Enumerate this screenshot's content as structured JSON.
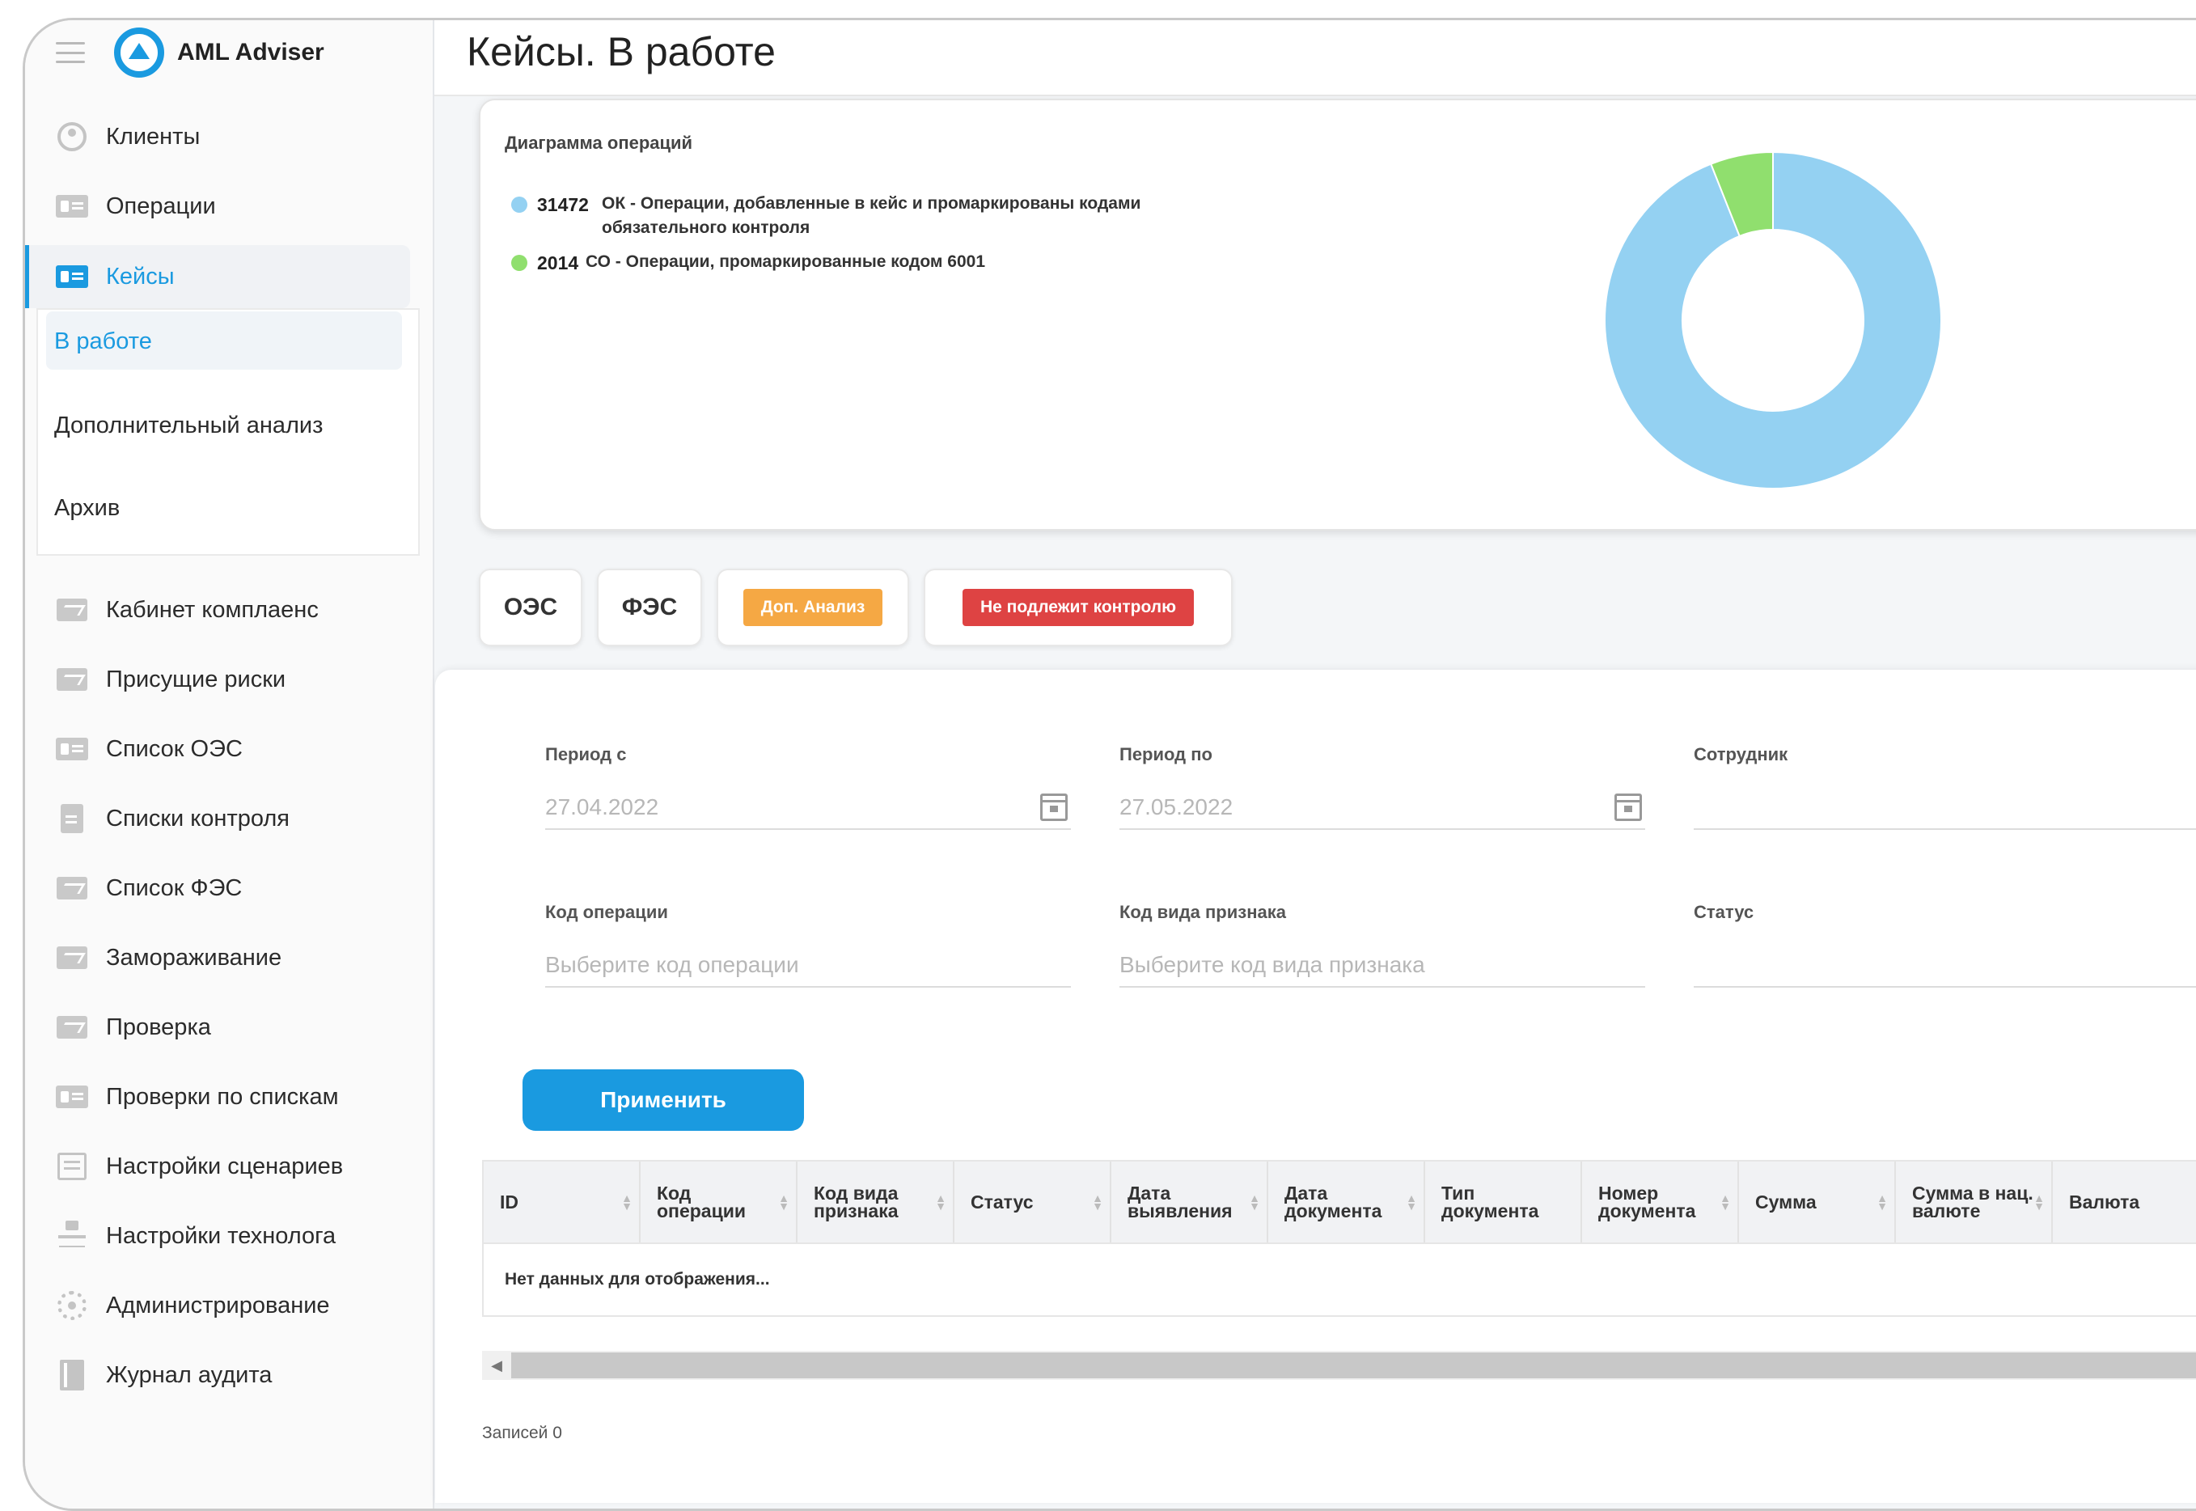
{
  "app": {
    "brand": "AML Adviser"
  },
  "sidebar": {
    "items": [
      {
        "label": "Клиенты",
        "icon": "user-icon"
      },
      {
        "label": "Операции",
        "icon": "card-icon"
      },
      {
        "label": "Кейсы",
        "icon": "card-icon"
      },
      {
        "label": "Кабинет комплаенс",
        "icon": "chart-icon"
      },
      {
        "label": "Присущие риски",
        "icon": "chart-icon"
      },
      {
        "label": "Список ОЭС",
        "icon": "card-icon"
      },
      {
        "label": "Списки контроля",
        "icon": "document-icon"
      },
      {
        "label": "Список ФЭС",
        "icon": "chart-icon"
      },
      {
        "label": "Замораживание",
        "icon": "chart-icon"
      },
      {
        "label": "Проверка",
        "icon": "chart-icon"
      },
      {
        "label": "Проверки по спискам",
        "icon": "card-icon"
      },
      {
        "label": "Настройки сценариев",
        "icon": "list-icon"
      },
      {
        "label": "Настройки технолога",
        "icon": "tree-icon"
      },
      {
        "label": "Администрирование",
        "icon": "gear-icon"
      },
      {
        "label": "Журнал аудита",
        "icon": "book-icon"
      }
    ],
    "submenu": [
      "В работе",
      "Дополнительный анализ",
      "Архив"
    ]
  },
  "header": {
    "title": "Кейсы. В работе"
  },
  "chart_data": {
    "type": "pie",
    "title": "Диаграмма операций",
    "slices": [
      {
        "value": 31472,
        "label": "ОК - Операции, добавленные в кейс и промаркированы кодами обязательного контроля",
        "color": "#94d1f2"
      },
      {
        "value": 2014,
        "label": "СО - Операции, промаркированные кодом 6001",
        "color": "#90df6e"
      }
    ]
  },
  "tabs": {
    "oes": "ОЭС",
    "fes": "ФЭС",
    "dop": {
      "label": "Доп. Анализ",
      "color": "#f5a844"
    },
    "not_controlled": {
      "label": "Не подлежит контролю",
      "color": "#de4343"
    }
  },
  "filters": {
    "period_from": {
      "label": "Период с",
      "value": "27.04.2022"
    },
    "period_to": {
      "label": "Период по",
      "value": "27.05.2022"
    },
    "employee": {
      "label": "Сотрудник",
      "value": ""
    },
    "op_code": {
      "label": "Код операции",
      "placeholder": "Выберите код операции"
    },
    "sign_code": {
      "label": "Код вида признака",
      "placeholder": "Выберите код вида признака"
    },
    "status": {
      "label": "Статус",
      "value": ""
    },
    "apply": "Применить"
  },
  "table": {
    "columns": [
      "ID",
      "Код операции",
      "Код вида признака",
      "Статус",
      "Дата выявления",
      "Дата документа",
      "Тип документа",
      "Номер документа",
      "Сумма",
      "Сумма в нац. валюте",
      "Валюта"
    ],
    "empty": "Нет данных для отображения...",
    "records": "Записей 0"
  },
  "colors": {
    "accent": "#1a9ae0"
  }
}
